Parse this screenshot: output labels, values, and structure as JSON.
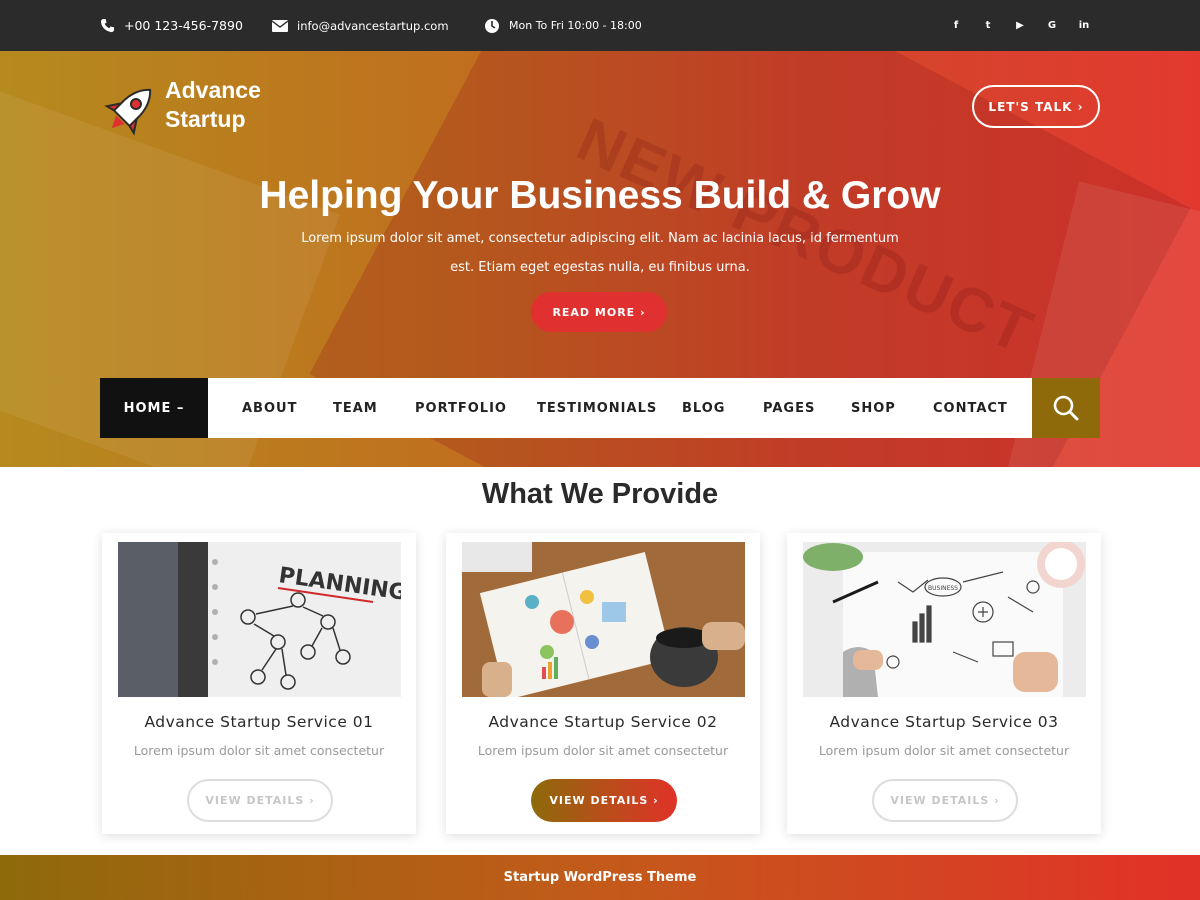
{
  "topbar": {
    "phone": "+00 123-456-7890",
    "email": "info@advancestartup.com",
    "hours": "Mon To Fri 10:00 - 18:00",
    "social": [
      {
        "icon": "facebook-icon",
        "glyph": "f"
      },
      {
        "icon": "twitter-icon",
        "glyph": "t"
      },
      {
        "icon": "youtube-icon",
        "glyph": "▶"
      },
      {
        "icon": "google-icon",
        "glyph": "G"
      },
      {
        "icon": "linkedin-icon",
        "glyph": "in"
      }
    ]
  },
  "logo": {
    "line1": "Advance",
    "line2": "Startup"
  },
  "hero": {
    "bg_word": "NEW PRODUCT",
    "cta_talk": "LET'S TALK ›",
    "headline": "Helping Your Business Build & Grow",
    "subline": "Lorem ipsum dolor sit amet, consectetur adipiscing elit. Nam ac lacinia lacus, id fermentum est. Etiam eget egestas nulla, eu finibus urna.",
    "read_more": "READ MORE ›"
  },
  "nav": {
    "home": "HOME –",
    "items": [
      "ABOUT",
      "TEAM",
      "PORTFOLIO",
      "TESTIMONIALS",
      "BLOG",
      "PAGES",
      "SHOP",
      "CONTACT"
    ]
  },
  "services": {
    "title": "What We Provide",
    "cards": [
      {
        "title": "Advance Startup Service 01",
        "desc": "Lorem ipsum dolor sit amet consectetur",
        "button": "VIEW DETAILS ›",
        "image_word": "PLANNING"
      },
      {
        "title": "Advance Startup Service 02",
        "desc": "Lorem ipsum dolor sit amet consectetur",
        "button": "VIEW DETAILS ›"
      },
      {
        "title": "Advance Startup Service 03",
        "desc": "Lorem ipsum dolor sit amet consectetur",
        "button": "VIEW DETAILS ›",
        "image_word": "BUSINESS"
      }
    ]
  },
  "footer": {
    "text": "Startup WordPress Theme"
  },
  "colors": {
    "accent_red": "#e03030",
    "accent_gold": "#8e6a0b",
    "topbar": "#2b2b2b"
  }
}
